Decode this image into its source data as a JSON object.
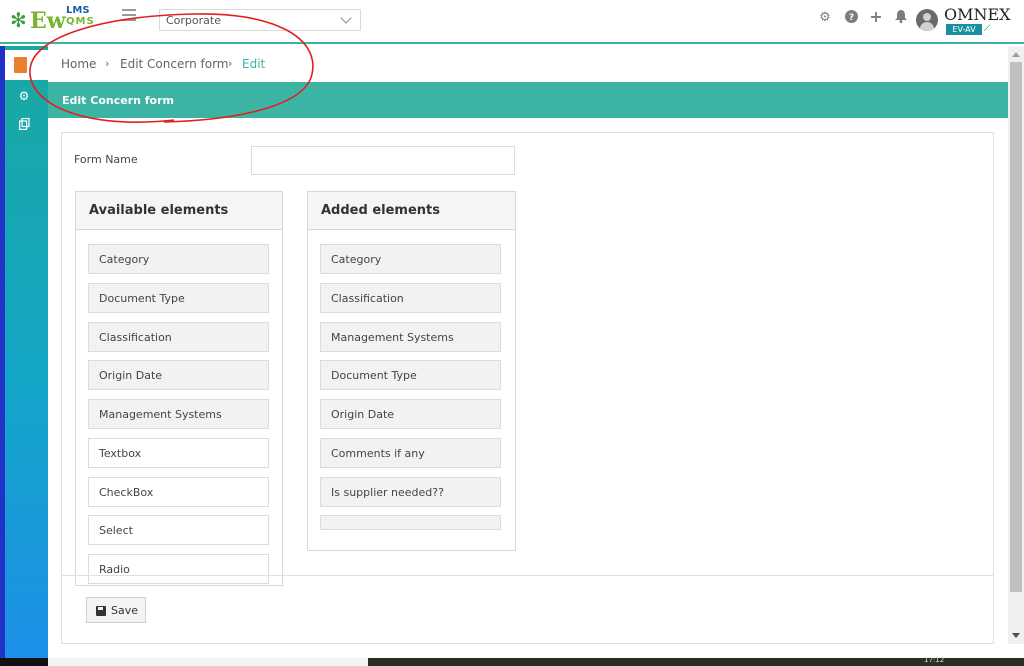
{
  "header": {
    "logo": {
      "main": "Ew",
      "sup": "LMS",
      "sub": "QMS"
    },
    "org_select": {
      "value": "Corporate"
    },
    "icons": [
      "gear-icon",
      "help-icon",
      "plus-icon",
      "bell-icon",
      "user-avatar-icon"
    ],
    "brand": {
      "name": "OMNEX",
      "tag": "EV-AV"
    }
  },
  "sidebar": {
    "items": [
      {
        "icon": "form-document-icon",
        "active": true
      },
      {
        "icon": "settings-cogs-icon",
        "active": false
      },
      {
        "icon": "copy-icon",
        "active": false
      }
    ]
  },
  "breadcrumb": {
    "items": [
      "Home",
      "Edit Concern form",
      "Edit"
    ],
    "separator": "›"
  },
  "section": {
    "title": "Edit Concern form"
  },
  "form": {
    "name_label": "Form Name",
    "name_value": "",
    "available": {
      "title": "Available elements",
      "items": [
        "Category",
        "Document Type",
        "Classification",
        "Origin Date",
        "Management Systems",
        "Textbox",
        "CheckBox",
        "Select",
        "Radio"
      ]
    },
    "added": {
      "title": "Added elements",
      "items": [
        "Category",
        "Classification",
        "Management Systems",
        "Document Type",
        "Origin Date",
        "Comments if any",
        "Is supplier needed??"
      ]
    },
    "save_label": "Save"
  },
  "taskbar": {
    "clock": "17:12"
  },
  "colors": {
    "accent": "#3cb4a4",
    "sidebar_edge": "#2232c8",
    "annotation": "#e02020"
  }
}
